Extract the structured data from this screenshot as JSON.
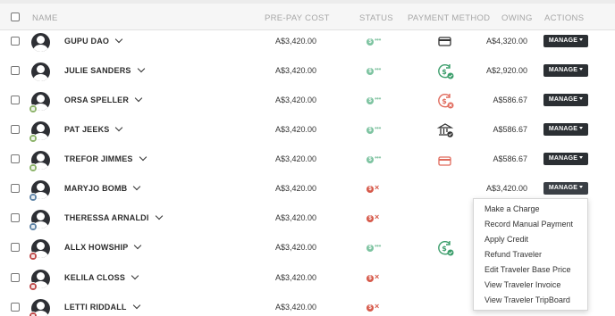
{
  "header": {
    "name": "NAME",
    "prepay_cost": "PRE-PAY COST",
    "status": "STATUS",
    "payment_method": "PAYMENT METHOD",
    "owing": "OWING",
    "actions": "ACTIONS"
  },
  "colors": {
    "status_ok": "#7cc3a0",
    "status_bad": "#d6594a",
    "button_dark": "#2b2f33",
    "badge_green": "#8cb36a",
    "badge_blue": "#5f84a6",
    "badge_red": "#c04a4a"
  },
  "rows": [
    {
      "name": "GUPU DAO",
      "prepay": "A$3,420.00",
      "status": "paid",
      "status_icon": "dollar-check-icon",
      "payment_icon": "credit-card-icon",
      "owing": "A$4,320.00",
      "action": "MANAGE"
    },
    {
      "name": "JULIE SANDERS",
      "prepay": "A$3,420.00",
      "status": "paid",
      "status_icon": "dollar-check-icon",
      "payment_icon": "cash-paid-icon",
      "owing": "A$2,920.00",
      "action": "MANAGE"
    },
    {
      "name": "ORSA SPELLER",
      "prepay": "A$3,420.00",
      "status": "paid",
      "status_icon": "dollar-check-icon",
      "payment_icon": "cash-failed-icon",
      "owing": "A$586.67",
      "action": "MANAGE",
      "avatar_badge": "green"
    },
    {
      "name": "PAT JEEKS",
      "prepay": "A$3,420.00",
      "status": "paid",
      "status_icon": "dollar-check-icon",
      "payment_icon": "bank-icon",
      "owing": "A$586.67",
      "action": "MANAGE",
      "avatar_badge": "green"
    },
    {
      "name": "TREFOR JIMMES",
      "prepay": "A$3,420.00",
      "status": "paid",
      "status_icon": "dollar-check-icon",
      "payment_icon": "credit-card-red-icon",
      "owing": "A$586.67",
      "action": "MANAGE",
      "avatar_badge": "green"
    },
    {
      "name": "MARYJO BOMB",
      "prepay": "A$3,420.00",
      "status": "unpaid",
      "status_icon": "dollar-x-icon",
      "payment_icon": "",
      "owing": "A$3,420.00",
      "action": "MANAGE",
      "avatar_badge": "blue"
    },
    {
      "name": "THERESSA ARNALDI",
      "prepay": "A$3,420.00",
      "status": "unpaid",
      "status_icon": "dollar-x-icon",
      "payment_icon": "",
      "owing": "",
      "action": "",
      "avatar_badge": "blue"
    },
    {
      "name": "ALLX HOWSHIP",
      "prepay": "A$3,420.00",
      "status": "paid",
      "status_icon": "dollar-check-icon",
      "payment_icon": "cash-paid-icon",
      "owing": "",
      "action": "",
      "avatar_badge": "red"
    },
    {
      "name": "KELILA CLOSS",
      "prepay": "A$3,420.00",
      "status": "unpaid",
      "status_icon": "dollar-x-icon",
      "payment_icon": "",
      "owing": "",
      "action": "",
      "avatar_badge": "red"
    },
    {
      "name": "LETTI RIDDALL",
      "prepay": "A$3,420.00",
      "status": "unpaid",
      "status_icon": "dollar-x-icon",
      "payment_icon": "",
      "owing": "",
      "action": "",
      "avatar_badge": "red"
    }
  ],
  "dropdown": {
    "items": [
      "Make a Charge",
      "Record Manual Payment",
      "Apply Credit",
      "Refund Traveler",
      "Edit Traveler Base Price",
      "View Traveler Invoice",
      "View Traveler TripBoard"
    ]
  }
}
